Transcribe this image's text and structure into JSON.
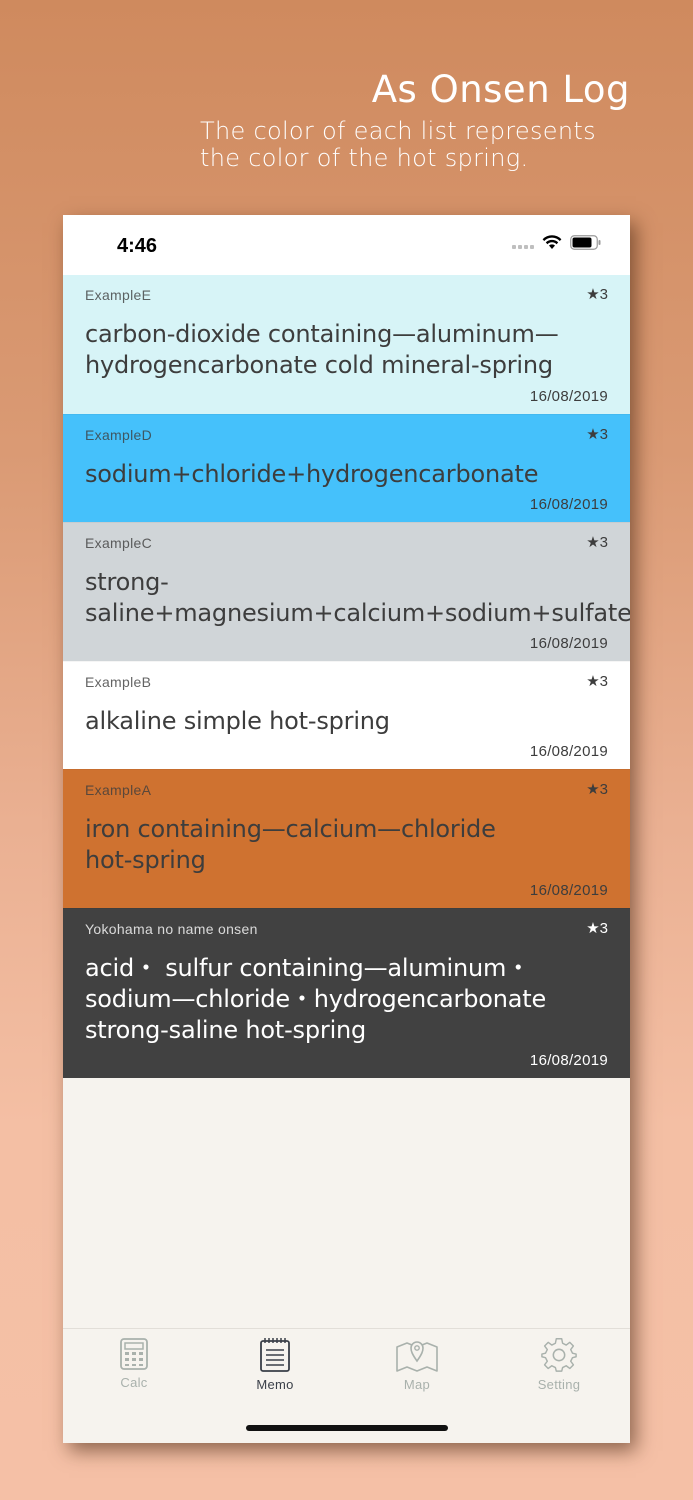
{
  "promo": {
    "title": "As Onsen Log",
    "subtitle_line1": "The color of each list represents",
    "subtitle_line2": "the color of the hot spring."
  },
  "status_bar": {
    "time": "4:46"
  },
  "memos": [
    {
      "name": "ExampleE",
      "rating": "★3",
      "quality_lines": [
        "carbon-dioxide containing—aluminum—",
        "hydrogencarbonate cold mineral-spring"
      ],
      "date": "16/08/2019",
      "bg_color": "#d7f4f7",
      "text_color": "#3d3d3d"
    },
    {
      "name": "ExampleD",
      "rating": "★3",
      "quality_lines": [
        "sodium+chloride+hydrogencarbonate"
      ],
      "date": "16/08/2019",
      "bg_color": "#45c1fb",
      "text_color": "#3d3d3d"
    },
    {
      "name": "ExampleC",
      "rating": "★3",
      "quality_lines": [
        "strong-",
        "saline+magnesium+calcium+sodium+sulfate"
      ],
      "date": "16/08/2019",
      "bg_color": "#d0d5d8",
      "text_color": "#3d3d3d"
    },
    {
      "name": "ExampleB",
      "rating": "★3",
      "quality_lines": [
        "alkaline simple hot-spring"
      ],
      "date": "16/08/2019",
      "bg_color": "#ffffff",
      "text_color": "#3d3d3d"
    },
    {
      "name": "ExampleA",
      "rating": "★3",
      "quality_lines": [
        "iron containing—calcium—chloride",
        "hot-spring"
      ],
      "date": "16/08/2019",
      "bg_color": "#cf7230",
      "text_color": "#3d3d3d"
    },
    {
      "name": "Yokohama no name onsen",
      "rating": "★3",
      "quality_lines": [
        "acid・ sulfur containing—aluminum・",
        "sodium—chloride・hydrogencarbonate",
        "strong-saline hot-spring"
      ],
      "date": "16/08/2019",
      "bg_color": "#414141",
      "text_color": "#ffffff"
    }
  ],
  "tabs": [
    {
      "label": "Calc",
      "icon": "calculator-icon",
      "active": false
    },
    {
      "label": "Memo",
      "icon": "memo-icon",
      "active": true
    },
    {
      "label": "Map",
      "icon": "map-icon",
      "active": false
    },
    {
      "label": "Setting",
      "icon": "gear-icon",
      "active": false
    }
  ],
  "colors": {
    "tab_active": "#3a3f48",
    "tab_inactive": "#a9b1ac"
  }
}
